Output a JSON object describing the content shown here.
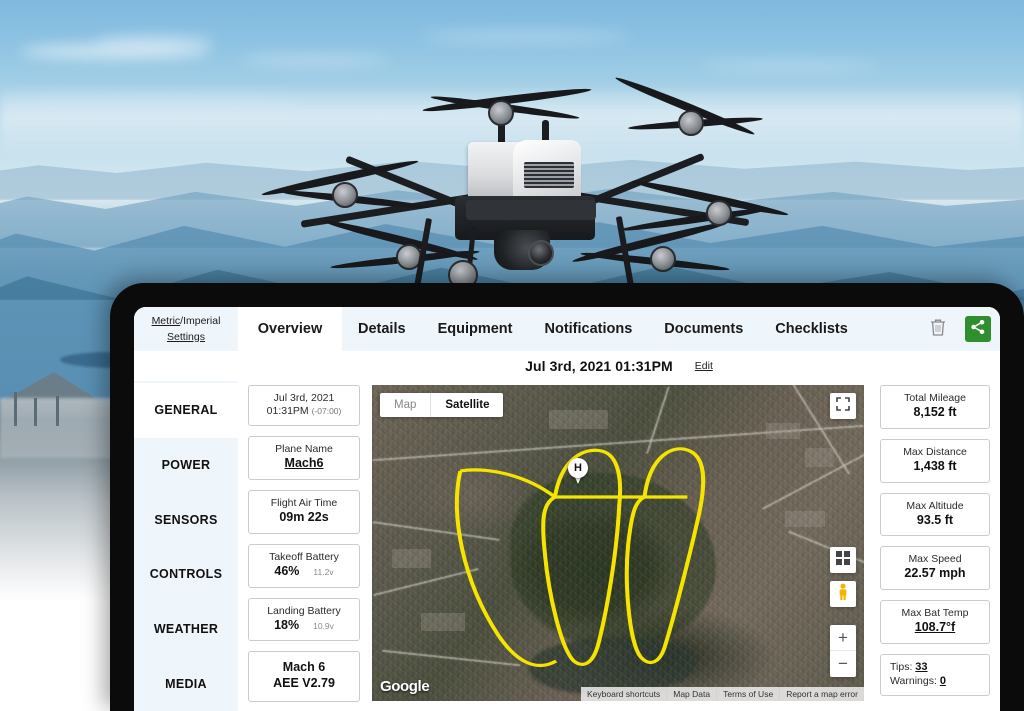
{
  "background": {
    "scene": "aerial-photo-coastline-mountains",
    "device": "tablet-hexacopter-drone"
  },
  "units": {
    "metric_label": "Metric",
    "separator": "/",
    "imperial_label": "Imperial",
    "settings_label": "Settings"
  },
  "tabs": [
    {
      "label": "Overview",
      "active": true
    },
    {
      "label": "Details",
      "active": false
    },
    {
      "label": "Equipment",
      "active": false
    },
    {
      "label": "Notifications",
      "active": false
    },
    {
      "label": "Documents",
      "active": false
    },
    {
      "label": "Checklists",
      "active": false
    }
  ],
  "actions": {
    "delete_icon": "trash-icon",
    "share_icon": "share-icon",
    "share_color": "#2f8f2f"
  },
  "header": {
    "title": "Jul 3rd, 2021 01:31PM",
    "edit_label": "Edit"
  },
  "sidebar": {
    "items": [
      {
        "label": "GENERAL",
        "active": true
      },
      {
        "label": "POWER",
        "active": false
      },
      {
        "label": "SENSORS",
        "active": false
      },
      {
        "label": "CONTROLS",
        "active": false
      },
      {
        "label": "WEATHER",
        "active": false
      },
      {
        "label": "MEDIA",
        "active": false
      }
    ]
  },
  "left_cards": {
    "datetime": {
      "date": "Jul 3rd, 2021",
      "time": "01:31PM",
      "timezone": "(-07:00)"
    },
    "plane": {
      "key": "Plane Name",
      "value": "Mach6"
    },
    "air_time": {
      "key": "Flight Air Time",
      "value": "09m 22s"
    },
    "takeoff_battery": {
      "key": "Takeoff Battery",
      "value": "46%",
      "voltage": "11.2v"
    },
    "landing_battery": {
      "key": "Landing Battery",
      "value": "18%",
      "voltage": "10.9v"
    },
    "model": {
      "line1": "Mach 6",
      "line2": "AEE V2.79"
    }
  },
  "right_cards": {
    "total_mileage": {
      "key": "Total Mileage",
      "value": "8,152 ft"
    },
    "max_distance": {
      "key": "Max Distance",
      "value": "1,438 ft"
    },
    "max_altitude": {
      "key": "Max Altitude",
      "value": "93.5 ft"
    },
    "max_speed": {
      "key": "Max Speed",
      "value": "22.57 mph"
    },
    "max_bat_temp": {
      "key": "Max Bat Temp",
      "value": "108.7°f"
    },
    "tips_warnings": {
      "tips_label": "Tips:",
      "tips_value": "33",
      "warnings_label": "Warnings:",
      "warnings_value": "0"
    }
  },
  "map": {
    "type_map_label": "Map",
    "type_satellite_label": "Satellite",
    "active_type": "Satellite",
    "fullscreen_icon": "fullscreen-icon",
    "tiles_icon": "map-tiles-icon",
    "pegman_icon": "street-view-pegman-icon",
    "zoom_in_label": "+",
    "zoom_out_label": "−",
    "attribution_logo": "Google",
    "home_marker_label": "H",
    "flight_path_color": "#f5e400",
    "footer": [
      "Keyboard shortcuts",
      "Map Data",
      "Terms of Use",
      "Report a map error"
    ]
  }
}
